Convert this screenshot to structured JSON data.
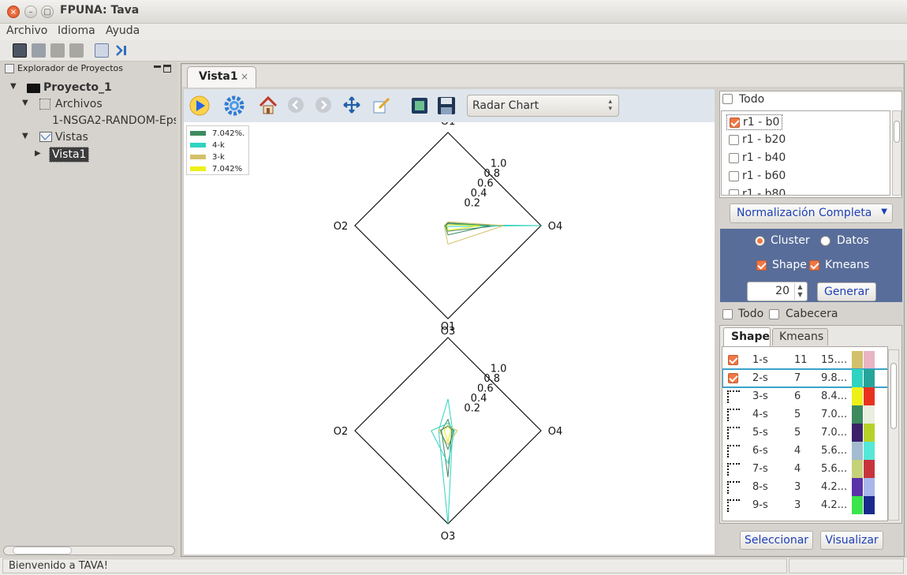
{
  "window": {
    "title": "FPUNA: Tava"
  },
  "menu": [
    "Archivo",
    "Idioma",
    "Ayuda"
  ],
  "explorer": {
    "title": "Explorador de Proyectos",
    "project": "Proyecto_1",
    "archivos": "Archivos",
    "file": "1-NSGA2-RANDOM-Eps(",
    "vistas": "Vistas",
    "vista": "Vista1"
  },
  "tab": {
    "label": "Vista1",
    "close": "×"
  },
  "plot_toolbar": {
    "chart_type": "Radar Chart"
  },
  "legend": [
    {
      "label": "7.042%.",
      "color": "#3d8a5e"
    },
    {
      "label": "4-k",
      "color": "#2fd3c1"
    },
    {
      "label": "3-k",
      "color": "#d3c06a"
    },
    {
      "label": "7.042%",
      "color": "#eef01a"
    }
  ],
  "chart_data": [
    {
      "type": "radar",
      "axes": [
        "O1",
        "O4",
        "O3",
        "O2"
      ],
      "rticks": [
        "0.2",
        "0.4",
        "0.6",
        "0.8",
        "1.0"
      ],
      "series": [
        {
          "color": "#3d8a5e",
          "values": [
            0.02,
            0.55,
            0.06,
            0.02
          ]
        },
        {
          "color": "#2fd3c1",
          "values": [
            0.01,
            1.0,
            0.01,
            0.02
          ]
        },
        {
          "color": "#d3c06a",
          "values": [
            0.04,
            0.6,
            0.2,
            0.04
          ]
        },
        {
          "color": "#eef01a",
          "values": [
            0.01,
            0.35,
            0.05,
            0.01
          ]
        },
        {
          "color": "#3d8a5e",
          "values": [
            0.03,
            0.45,
            0.1,
            0.03
          ]
        }
      ]
    },
    {
      "type": "radar",
      "axes": [
        "O1",
        "O4",
        "O3",
        "O2"
      ],
      "rticks": [
        "0.2",
        "0.4",
        "0.6",
        "0.8",
        "1.0"
      ],
      "series": [
        {
          "color": "#2fd3c1",
          "values": [
            0.34,
            0.05,
            1.0,
            0.1
          ]
        },
        {
          "color": "#3d8a5e",
          "values": [
            0.12,
            0.04,
            0.5,
            0.07
          ]
        },
        {
          "color": "#2fd3c1",
          "values": [
            0.08,
            0.07,
            0.35,
            0.18
          ]
        },
        {
          "color": "#d3c06a",
          "values": [
            0.05,
            0.1,
            0.15,
            0.1
          ]
        },
        {
          "color": "#eef01a",
          "values": [
            0.06,
            0.03,
            0.12,
            0.04
          ]
        },
        {
          "color": "#3d8a5e",
          "values": [
            0.05,
            0.06,
            0.2,
            0.08
          ]
        }
      ]
    }
  ],
  "right": {
    "todo": "Todo",
    "runs": [
      {
        "label": "r1 - b0",
        "checked": true
      },
      {
        "label": "r1 - b20",
        "checked": false
      },
      {
        "label": "r1 - b40",
        "checked": false
      },
      {
        "label": "r1 - b60",
        "checked": false
      },
      {
        "label": "r1 - b80",
        "checked": false
      }
    ],
    "normalizacion": "Normalización Completa",
    "cluster": "Cluster",
    "datos": "Datos",
    "shape": "Shape",
    "kmeans": "Kmeans",
    "count": "20",
    "generar": "Generar",
    "todo2": "Todo",
    "cabecera": "Cabecera",
    "tab_shape": "Shape",
    "tab_kmeans": "Kmeans",
    "rows": [
      {
        "name": "1-s",
        "n": "11",
        "pct": "15....",
        "c1": "#d3c06a",
        "c2": "#e9b4c4",
        "checked": true
      },
      {
        "name": "2-s",
        "n": "7",
        "pct": "9.8...",
        "c1": "#2fd3c1",
        "c2": "#26a49a",
        "checked": true
      },
      {
        "name": "3-s",
        "n": "6",
        "pct": "8.4...",
        "c1": "#eef01a",
        "c2": "#e8321f",
        "checked": false
      },
      {
        "name": "4-s",
        "n": "5",
        "pct": "7.0...",
        "c1": "#3d8a5e",
        "c2": "#e9eedf",
        "checked": false
      },
      {
        "name": "5-s",
        "n": "5",
        "pct": "7.0...",
        "c1": "#3b216b",
        "c2": "#b6d22a",
        "checked": false
      },
      {
        "name": "6-s",
        "n": "4",
        "pct": "5.6...",
        "c1": "#a3bccf",
        "c2": "#55e8d9",
        "checked": false
      },
      {
        "name": "7-s",
        "n": "4",
        "pct": "5.6...",
        "c1": "#c6d27a",
        "c2": "#c8343e",
        "checked": false
      },
      {
        "name": "8-s",
        "n": "3",
        "pct": "4.2...",
        "c1": "#5b33a8",
        "c2": "#a9b6ec",
        "checked": false
      },
      {
        "name": "9-s",
        "n": "3",
        "pct": "4.2...",
        "c1": "#3be54c",
        "c2": "#1a2a8c",
        "checked": false
      }
    ],
    "seleccionar": "Seleccionar",
    "visualizar": "Visualizar"
  },
  "status": "Bienvenido a TAVA!"
}
